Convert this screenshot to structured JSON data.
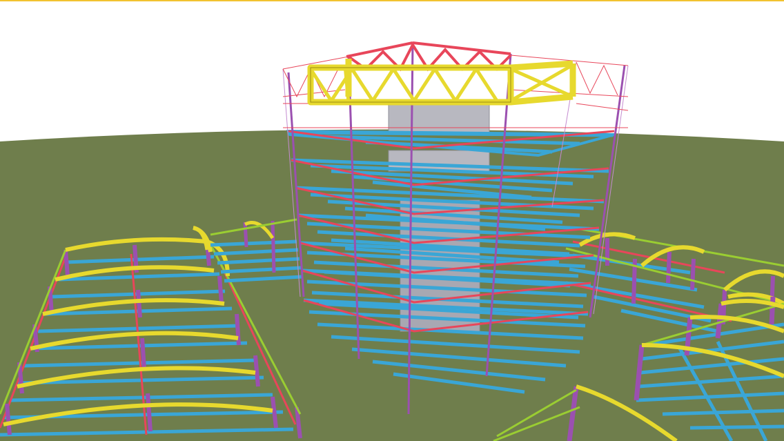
{
  "viewport": {
    "kind": "3d-structural-model-view",
    "colors": {
      "sky": "#ffffff",
      "ground": "#6f7e4c",
      "top_accent_line": "#f2c230",
      "floor_beams": "#3aa6d6",
      "columns": "#9b50b0",
      "girders": "#e8465a",
      "roof_trusses": "#e7d92e",
      "arched_rafters": "#e7d92e",
      "bracing": "#9acd32",
      "core_walls": "#b8b8c0"
    },
    "model_parts": [
      "central-tower",
      "tower-core",
      "tower-floor-plates",
      "top-truss-hat",
      "left-arched-shed",
      "connecting-bridge",
      "right-arched-shed",
      "front-right-shed"
    ]
  }
}
